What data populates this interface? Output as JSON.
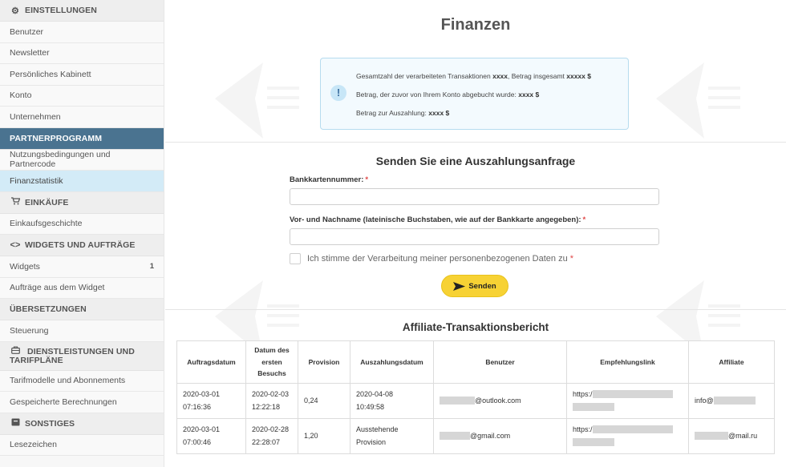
{
  "sidebar": {
    "settings": {
      "title": "EINSTELLUNGEN",
      "items": [
        "Benutzer",
        "Newsletter",
        "Persönliches Kabinett",
        "Konto",
        "Unternehmen"
      ]
    },
    "partner": {
      "title": "PARTNERPROGRAMM",
      "items": [
        "Nutzungsbedingungen und Partnercode",
        "Finanzstatistik"
      ]
    },
    "purchases": {
      "title": "EINKÄUFE",
      "items": [
        "Einkaufsgeschichte"
      ]
    },
    "widgets": {
      "title": "WIDGETS UND AUFTRÄGE",
      "items": [
        "Widgets",
        "Aufträge aus dem Widget"
      ],
      "widgets_badge": "1"
    },
    "translations": {
      "title": "ÜBERSETZUNGEN",
      "items": [
        "Steuerung"
      ]
    },
    "services": {
      "title_line1": "DIENSTLEISTUNGEN UND",
      "title_line2": "TARIFPLÄNE",
      "items": [
        "Tarifmodelle und Abonnements",
        "Gespeicherte Berechnungen"
      ]
    },
    "other": {
      "title": "SONSTIGES",
      "items": [
        "Lesezeichen"
      ]
    }
  },
  "main": {
    "title": "Finanzen",
    "info": {
      "line1_text": "Gesamtzahl der verarbeiteten Transaktionen ",
      "line1_count": "xxxx",
      "line1_mid": ", Betrag insgesamt ",
      "line1_amount": "xxxxx $",
      "line2_text": "Betrag, der zuvor von Ihrem Konto abgebucht wurde: ",
      "line2_amount": "xxxx $",
      "line3_text": "Betrag zur Auszahlung: ",
      "line3_amount": "xxxx $"
    },
    "form": {
      "title": "Senden Sie eine Auszahlungsanfrage",
      "card_label": "Bankkartennummer:",
      "name_label": "Vor- und Nachname (lateinische Buchstaben, wie auf der Bankkarte angegeben):",
      "required_mark": "*",
      "card_value": "",
      "name_value": "",
      "consent_label": "Ich stimme der Verarbeitung meiner personenbezogenen Daten zu",
      "send_label": "Senden"
    },
    "report": {
      "title": "Affiliate-Transaktionsbericht",
      "columns": [
        "Auftragsdatum",
        "Datum des ersten Besuchs",
        "Provision",
        "Auszahlungsdatum",
        "Benutzer",
        "Empfehlungslink",
        "Affiliate"
      ],
      "rows": [
        {
          "order_date": "2020-03-01",
          "order_time": "07:16:36",
          "visit_date": "2020-02-03",
          "visit_time": "12:22:18",
          "commission": "0,24",
          "payout_1": "2020-04-08",
          "payout_2": "10:49:58",
          "user": "@outlook.com",
          "link": "https:/",
          "affiliate": "info@"
        },
        {
          "order_date": "2020-03-01",
          "order_time": "07:00:46",
          "visit_date": "2020-02-28",
          "visit_time": "22:28:07",
          "commission": "1,20",
          "payout_1": "Ausstehende",
          "payout_2": "Provision",
          "user": "@gmail.com",
          "link": "https:/",
          "affiliate": "@mail.ru"
        }
      ]
    }
  },
  "colors": {
    "active_section": "#4a7390",
    "selected_item": "#d3ebf7",
    "send_button": "#f7d234",
    "required": "#e04848",
    "info_border": "#b6dcef"
  },
  "icons": {
    "settings": "gear-icon",
    "purchases": "cart-icon",
    "widgets": "code-icon",
    "services": "briefcase-icon",
    "other": "box-icon",
    "info": "exclamation-icon",
    "send": "send-arrow-icon"
  }
}
